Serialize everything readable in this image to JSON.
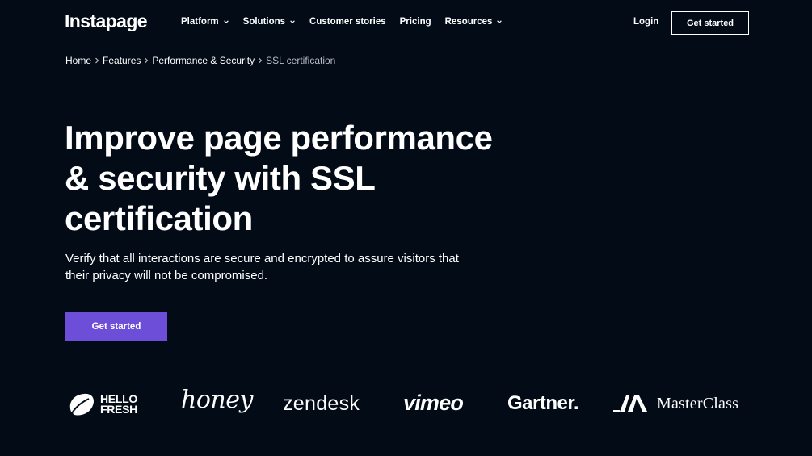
{
  "header": {
    "logo": "Instapage",
    "nav": [
      {
        "label": "Platform",
        "dropdown": true
      },
      {
        "label": "Solutions",
        "dropdown": true
      },
      {
        "label": "Customer stories",
        "dropdown": false
      },
      {
        "label": "Pricing",
        "dropdown": false
      },
      {
        "label": "Resources",
        "dropdown": true
      }
    ],
    "login": "Login",
    "cta": "Get started"
  },
  "breadcrumb": [
    "Home",
    "Features",
    "Performance & Security",
    "SSL certification"
  ],
  "hero": {
    "title_lines": [
      "Improve page performance",
      "& security with SSL",
      "certification"
    ],
    "subtitle_lines": [
      "Verify that all interactions are secure and encrypted to assure visitors that",
      "their privacy will not be compromised."
    ],
    "cta": "Get started"
  },
  "logos": {
    "hellofresh": [
      "HELLO",
      "FRESH"
    ],
    "honey": "honey",
    "zendesk": "zendesk",
    "vimeo": "vimeo",
    "gartner": "Gartner.",
    "masterclass": "MasterClass"
  },
  "colors": {
    "background": "#020b16",
    "accent": "#6c4ed9",
    "text": "#ffffff",
    "muted": "#b9bec7"
  }
}
